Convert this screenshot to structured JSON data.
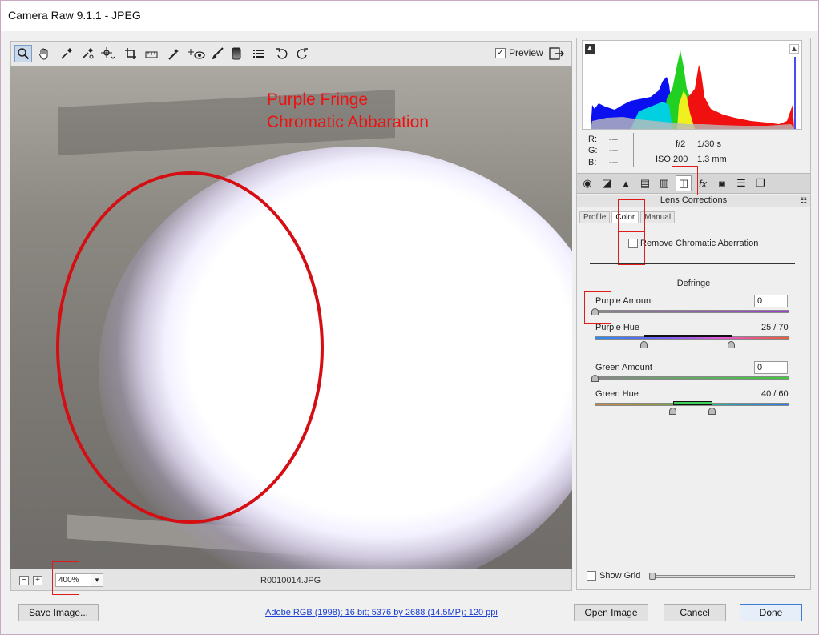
{
  "window": {
    "title": "Camera Raw 9.1.1  -  JPEG",
    "min": "—",
    "max": "☐",
    "close": "✕"
  },
  "toolbar": {
    "tools": [
      {
        "name": "zoom-tool",
        "glyph": "🔍"
      },
      {
        "name": "hand-tool",
        "glyph": "✋"
      },
      {
        "name": "white-balance-tool",
        "glyph": "✒"
      },
      {
        "name": "color-sampler-tool",
        "glyph": "✒"
      },
      {
        "name": "targeted-adjustment-tool",
        "glyph": "⊕"
      },
      {
        "name": "crop-tool",
        "glyph": "⌗"
      },
      {
        "name": "straighten-tool",
        "glyph": "▭"
      },
      {
        "name": "spot-removal-tool",
        "glyph": "✧"
      },
      {
        "name": "red-eye-tool",
        "glyph": "+👁"
      },
      {
        "name": "adjustment-brush-tool",
        "glyph": "🖌"
      },
      {
        "name": "graduated-filter-tool",
        "glyph": "■"
      },
      {
        "name": "preferences-tool",
        "glyph": "☰"
      },
      {
        "name": "rotate-ccw-tool",
        "glyph": "↺"
      },
      {
        "name": "rotate-cw-tool",
        "glyph": "↻"
      }
    ],
    "preview_label": "Preview",
    "preview_checked": "✓",
    "fullscreen": "⇥"
  },
  "annotation": {
    "line1": "Purple Fringe",
    "line2": "Chromatic Abbaration",
    "color": "#e11111"
  },
  "imagebar": {
    "zoom_out": "−",
    "zoom_in": "+",
    "zoom": "400%",
    "zoom_dropdown": "▾",
    "filename": "R0010014.JPG"
  },
  "readout": {
    "r_label": "R:",
    "g_label": "G:",
    "b_label": "B:",
    "r": "---",
    "g": "---",
    "b": "---",
    "aperture": "f/2",
    "shutter": "1/30 s",
    "iso": "ISO 200",
    "focal": "1.3 mm"
  },
  "panel": {
    "section_title": "Lens Corrections",
    "menu_glyph": "☷",
    "subtabs": [
      "Profile",
      "Color",
      "Manual"
    ],
    "remove_ca_label": "Remove Chromatic Aberration",
    "defringe_title": "Defringe",
    "purple_amount_label": "Purple Amount",
    "purple_amount_value": "0",
    "purple_hue_label": "Purple Hue",
    "purple_hue_value": "25 / 70",
    "green_amount_label": "Green Amount",
    "green_amount_value": "0",
    "green_hue_label": "Green Hue",
    "green_hue_value": "40 / 60",
    "show_grid_label": "Show Grid",
    "tab_icons": [
      "◉",
      "◪",
      "▲",
      "▤",
      "▥",
      "◫",
      "fx",
      "◙",
      "☰",
      "❐"
    ]
  },
  "bottom": {
    "save_image": "Save Image...",
    "workflow_link": "Adobe RGB (1998); 16 bit; 5376 by 2688 (14.5MP); 120 ppi",
    "open_image": "Open Image",
    "cancel": "Cancel",
    "done": "Done"
  }
}
